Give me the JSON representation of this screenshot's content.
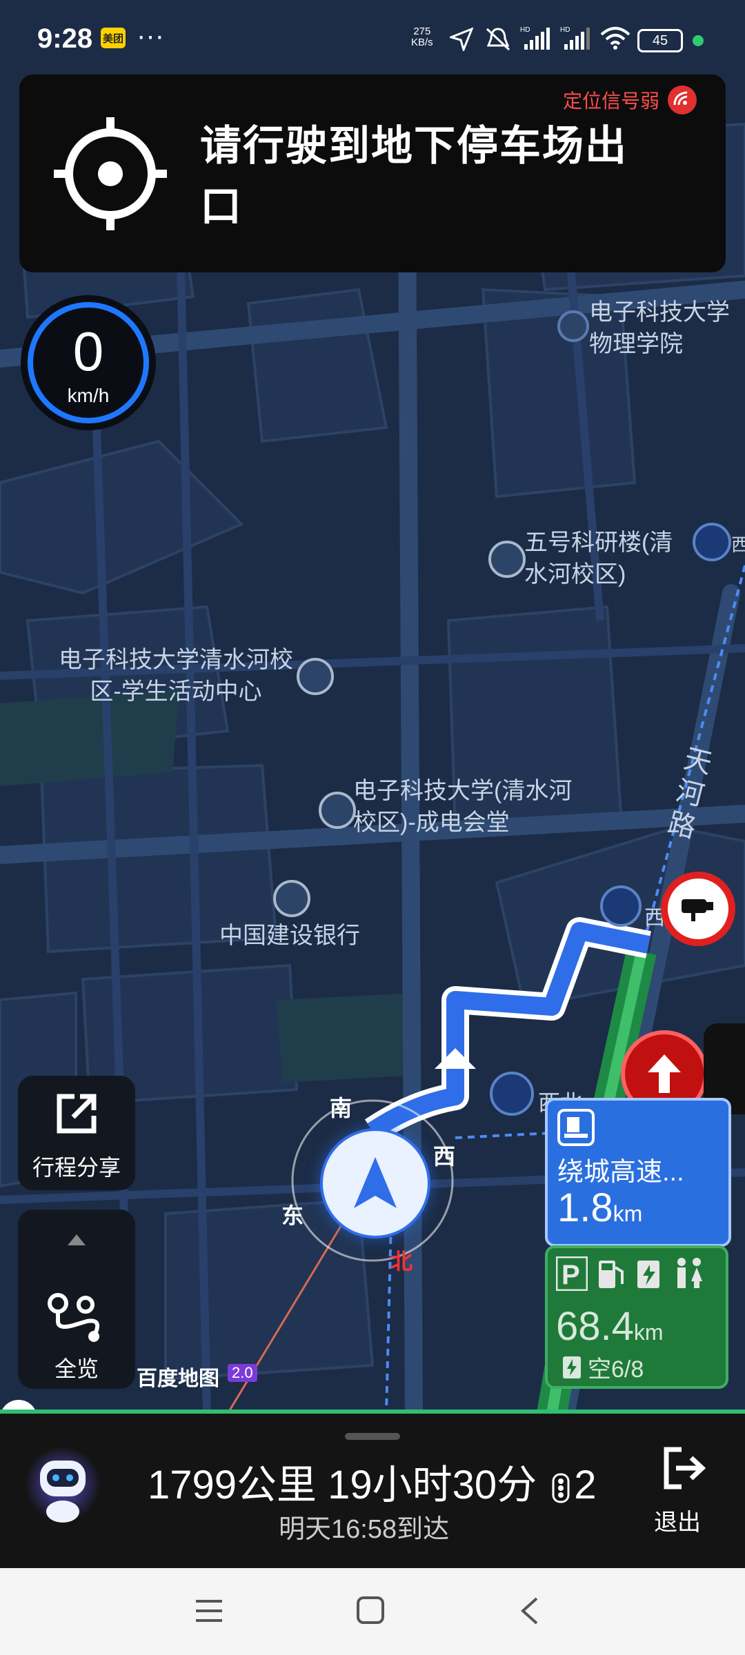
{
  "status_bar": {
    "time": "9:28",
    "app_badge": "美团",
    "more": "···",
    "net_speed_value": "275",
    "net_speed_unit": "KB/s",
    "battery": "45"
  },
  "banner": {
    "weak_signal": "定位信号弱",
    "instruction": "请行驶到地下停车场出口"
  },
  "speed": {
    "value": "0",
    "unit": "km/h"
  },
  "map": {
    "pois": [
      {
        "name": "电子科技大学物理学院"
      },
      {
        "name": "五号科研楼(清水河校区)"
      },
      {
        "name": "电子科技大学清水河校区-学生活动中心"
      },
      {
        "name": "电子科技大学(清水河校区)-成电会堂"
      },
      {
        "name": "中国建设银行"
      }
    ],
    "road_name": "天河路",
    "compass": {
      "n": "南",
      "e": "西",
      "w": "东",
      "s": "北"
    },
    "edge_labels": {
      "west_1": "西",
      "west_2": "西",
      "west_3": "西北"
    },
    "logo": "百度地图",
    "logo_badge": "2.0"
  },
  "left_buttons": {
    "share_label": "行程分享",
    "overview_label": "全览"
  },
  "guidance_sign": {
    "road": "绕城高速...",
    "distance": "1.8",
    "distance_unit": "km",
    "service_distance": "68.4",
    "service_unit": "km",
    "parking": "空6/8"
  },
  "bottom_panel": {
    "summary": "1799公里 19小时30分",
    "lights": "2",
    "eta": "明天16:58到达",
    "exit_label": "退出"
  }
}
